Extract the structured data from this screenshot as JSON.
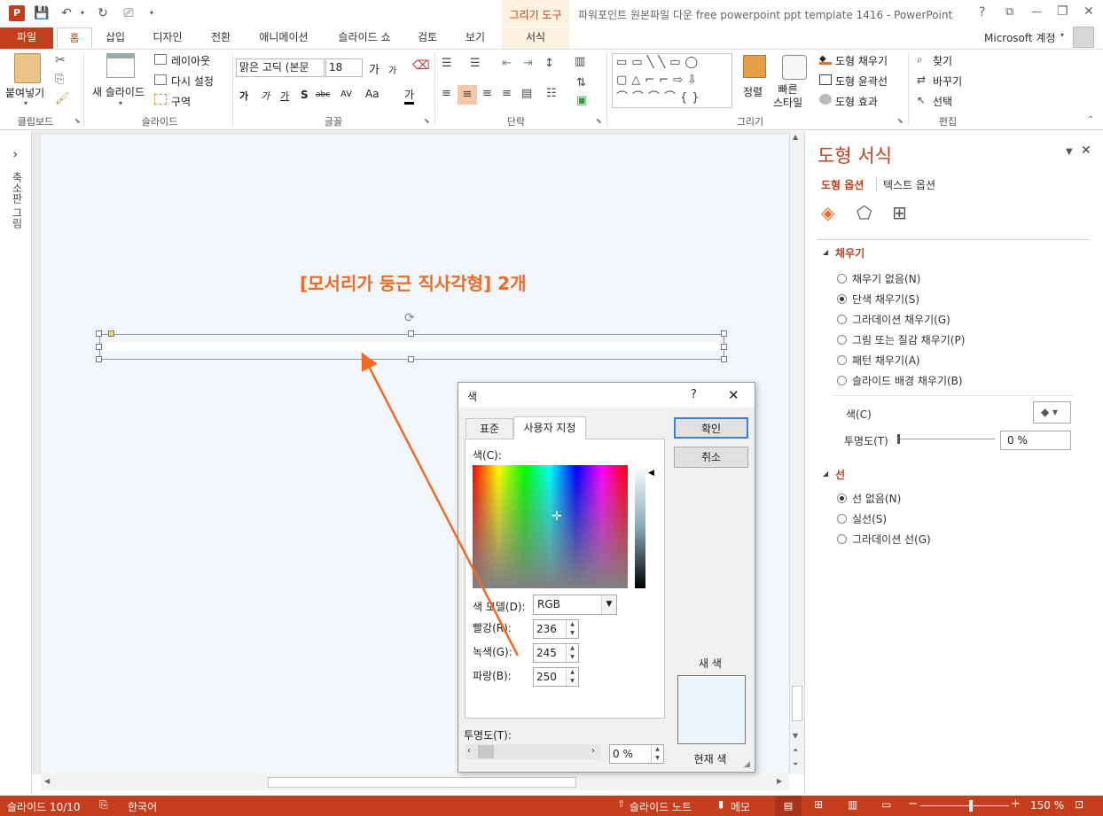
{
  "window": {
    "title": "파워포인트 원본파일 다운 free powerpoint ppt template 1416 - PowerPoint",
    "context_tab_header": "그리기 도구",
    "help": "?",
    "minimize": "—",
    "restore": "❐",
    "close": "✕",
    "account": "Microsoft 계정"
  },
  "tabs": [
    {
      "label": "파일"
    },
    {
      "label": "홈"
    },
    {
      "label": "삽입"
    },
    {
      "label": "디자인"
    },
    {
      "label": "전환"
    },
    {
      "label": "애니메이션"
    },
    {
      "label": "슬라이드 쇼"
    },
    {
      "label": "검토"
    },
    {
      "label": "보기"
    },
    {
      "label": "서식"
    }
  ],
  "ribbon": {
    "clipboard": {
      "label": "클립보드",
      "paste": "붙여넣기"
    },
    "slides": {
      "label": "슬라이드",
      "new_slide": "새 슬라이드",
      "layout": "레이아웃",
      "reset": "다시 설정",
      "section": "구역"
    },
    "font": {
      "label": "글꼴",
      "font_name": "맑은 고딕 (본문",
      "font_size": "18",
      "grow": "가",
      "shrink": "가",
      "bold": "가",
      "italic": "가",
      "underline": "가",
      "shadow": "S",
      "strike": "abc",
      "spacing": "AV",
      "case": "Aa",
      "color": "가"
    },
    "paragraph": {
      "label": "단락"
    },
    "drawing": {
      "label": "그리기",
      "arrange": "정렬",
      "quick_styles": "빠른\n스타일",
      "fill": "도형 채우기",
      "outline": "도형 윤곽선",
      "effects": "도형 효과"
    },
    "editing": {
      "label": "편집",
      "find": "찾기",
      "replace": "바꾸기",
      "select": "선택"
    }
  },
  "left_pane": {
    "label": "축소판 그림",
    "expand": "›"
  },
  "slide": {
    "heading": "[모서리가 둥근 직사각형] 2개"
  },
  "format_panel": {
    "title": "도형 서식",
    "tab_shape": "도형 옵션",
    "tab_text": "텍스트 옵션",
    "fill_section": "채우기",
    "fill_options": [
      {
        "label": "채우기 없음(N)",
        "selected": false
      },
      {
        "label": "단색 채우기(S)",
        "selected": true
      },
      {
        "label": "그라데이션 채우기(G)",
        "selected": false
      },
      {
        "label": "그림 또는 질감 채우기(P)",
        "selected": false
      },
      {
        "label": "패턴 채우기(A)",
        "selected": false
      },
      {
        "label": "슬라이드 배경 채우기(B)",
        "selected": false
      }
    ],
    "color_label": "색(C)",
    "transparency_label": "투명도(T)",
    "transparency_value": "0 %",
    "line_section": "선",
    "line_options": [
      {
        "label": "선 없음(N)",
        "selected": true
      },
      {
        "label": "실선(S)",
        "selected": false
      },
      {
        "label": "그라데이션 선(G)",
        "selected": false
      }
    ]
  },
  "color_dialog": {
    "title": "색",
    "help": "?",
    "close": "✕",
    "tab_standard": "표준",
    "tab_custom": "사용자 지정",
    "colors_label": "색(C):",
    "model_label": "색 모델(D):",
    "model_value": "RGB",
    "red_label": "빨강(R):",
    "red_value": "236",
    "green_label": "녹색(G):",
    "green_value": "245",
    "blue_label": "파랑(B):",
    "blue_value": "250",
    "transparency_label": "투명도(T):",
    "transparency_value": "0 %",
    "ok": "확인",
    "cancel": "취소",
    "new_label": "새 색",
    "current_label": "현재 색",
    "new_color": "#ECF5FA"
  },
  "status": {
    "slide": "슬라이드 10/10",
    "language": "한국어",
    "notes": "슬라이드 노트",
    "comments": "메모",
    "zoom": "150 %"
  },
  "colors": {
    "accent": "#C43E1C",
    "heading": "#F26A21",
    "arrow": "#F26A21"
  }
}
